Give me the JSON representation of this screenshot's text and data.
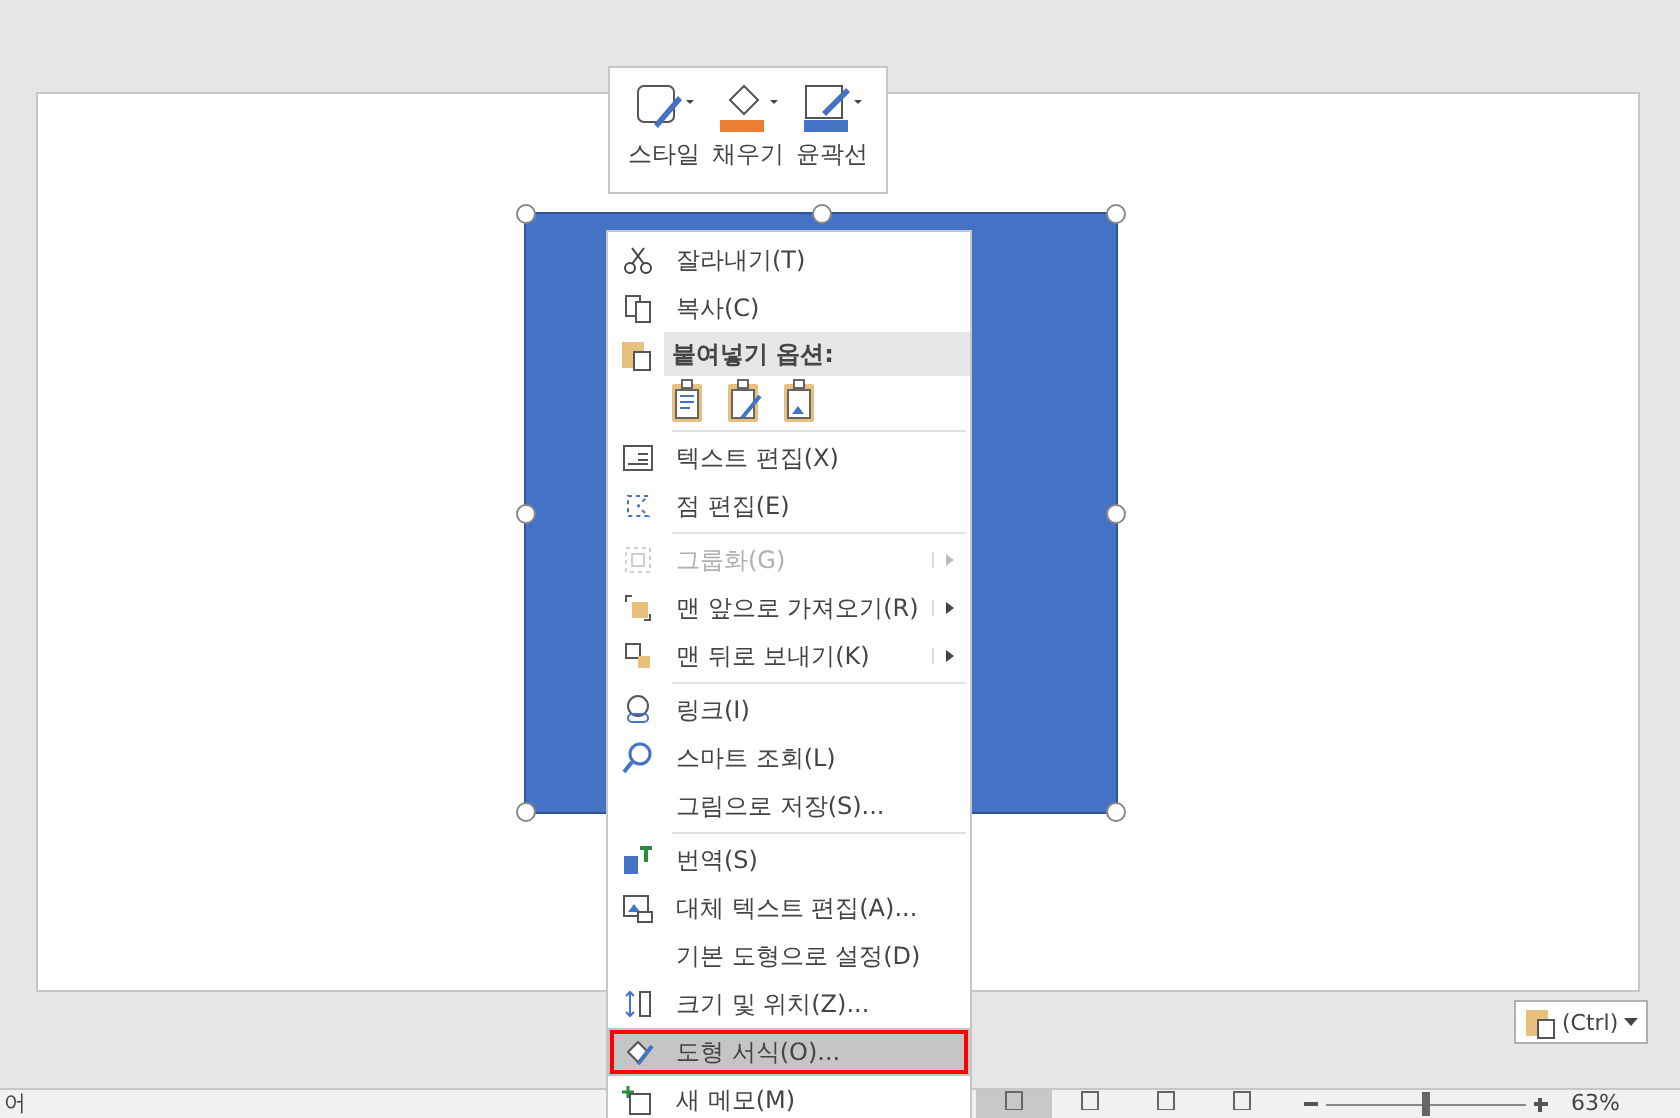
{
  "mini_toolbar": [
    {
      "label": "스타일"
    },
    {
      "label": "채우기",
      "color": "#ed7d31"
    },
    {
      "label": "윤곽선",
      "color": "#4472c4"
    }
  ],
  "shape": {
    "color": "#4472c4",
    "selected": true
  },
  "context_menu": {
    "groups": [
      [
        {
          "kind": "item",
          "label": "잘라내기(T)",
          "disabled": false,
          "submenu": false,
          "selected": false
        },
        {
          "kind": "item",
          "label": "복사(C)",
          "disabled": false,
          "submenu": false,
          "selected": false
        },
        {
          "kind": "header",
          "label": "붙여넣기 옵션:"
        },
        {
          "kind": "paste-options"
        }
      ],
      [
        {
          "kind": "item",
          "label": "텍스트 편집(X)",
          "disabled": false,
          "submenu": false,
          "selected": false
        },
        {
          "kind": "item",
          "label": "점 편집(E)",
          "disabled": false,
          "submenu": false,
          "selected": false
        }
      ],
      [
        {
          "kind": "item",
          "label": "그룹화(G)",
          "disabled": true,
          "submenu": true,
          "selected": false
        },
        {
          "kind": "item",
          "label": "맨 앞으로 가져오기(R)",
          "disabled": false,
          "submenu": true,
          "selected": false
        },
        {
          "kind": "item",
          "label": "맨 뒤로 보내기(K)",
          "disabled": false,
          "submenu": true,
          "selected": false
        }
      ],
      [
        {
          "kind": "item",
          "label": "링크(I)",
          "disabled": false,
          "submenu": false,
          "selected": false
        },
        {
          "kind": "item",
          "label": "스마트 조회(L)",
          "disabled": false,
          "submenu": false,
          "selected": false
        },
        {
          "kind": "item",
          "label": "그림으로 저장(S)...",
          "disabled": false,
          "submenu": false,
          "selected": false
        }
      ],
      [
        {
          "kind": "item",
          "label": "번역(S)",
          "disabled": false,
          "submenu": false,
          "selected": false
        },
        {
          "kind": "item",
          "label": "대체 텍스트 편집(A)...",
          "disabled": false,
          "submenu": false,
          "selected": false
        },
        {
          "kind": "item",
          "label": "기본 도형으로 설정(D)",
          "disabled": false,
          "submenu": false,
          "selected": false
        },
        {
          "kind": "item",
          "label": "크기 및 위치(Z)...",
          "disabled": false,
          "submenu": false,
          "selected": false
        },
        {
          "kind": "item",
          "label": "도형 서식(O)...",
          "disabled": false,
          "submenu": false,
          "selected": true,
          "outlined": true
        },
        {
          "kind": "item",
          "label": "새 메모(M)",
          "disabled": false,
          "submenu": false,
          "selected": false
        }
      ]
    ]
  },
  "paste_button": {
    "label": "(Ctrl)"
  },
  "status_bar": {
    "language": "어",
    "zoom": "63%",
    "zoom_slider": {
      "level": 0.5
    },
    "views": [
      {
        "selected": true
      },
      {
        "selected": false
      },
      {
        "selected": false
      },
      {
        "selected": false
      }
    ]
  }
}
